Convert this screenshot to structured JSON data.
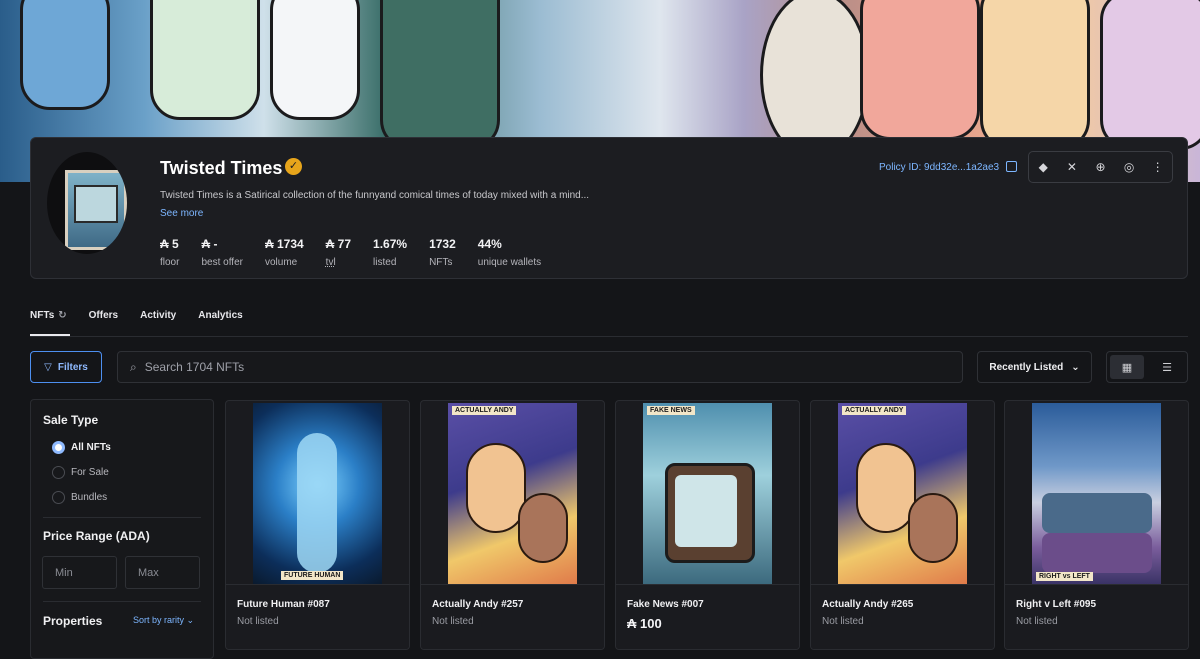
{
  "collection": {
    "title": "Twisted Times",
    "description": "Twisted Times is a Satirical collection of the funnyand comical times of today mixed with a mind...",
    "see_more": "See more",
    "policy": "Policy ID: 9dd32e...1a2ae3",
    "stats": [
      {
        "value": "₳ 5",
        "label": "floor"
      },
      {
        "value": "₳ -",
        "label": "best offer"
      },
      {
        "value": "₳ 1734",
        "label": "volume"
      },
      {
        "value": "₳ 77",
        "label": "tvl"
      },
      {
        "value": "1.67%",
        "label": "listed"
      },
      {
        "value": "1732",
        "label": "NFTs"
      },
      {
        "value": "44%",
        "label": "unique wallets"
      }
    ]
  },
  "tabs": [
    {
      "label": "NFTs"
    },
    {
      "label": "Offers"
    },
    {
      "label": "Activity"
    },
    {
      "label": "Analytics"
    }
  ],
  "toolbar": {
    "filters_label": "Filters",
    "search_placeholder": "Search 1704 NFTs",
    "sort_label": "Recently Listed"
  },
  "sidebar": {
    "sale_type_title": "Sale Type",
    "sale_options": [
      "All NFTs",
      "For Sale",
      "Bundles"
    ],
    "price_title": "Price Range (ADA)",
    "min_placeholder": "Min",
    "max_placeholder": "Max",
    "properties_title": "Properties",
    "sort_by_rarity": "Sort by rarity"
  },
  "cards": [
    {
      "name": "Future Human #087",
      "status": "Not listed",
      "art_label": "FUTURE HUMAN"
    },
    {
      "name": "Actually Andy #257",
      "status": "Not listed",
      "art_label": "ACTUALLY ANDY"
    },
    {
      "name": "Fake News #007",
      "price": "₳ 100",
      "art_label": "FAKE NEWS"
    },
    {
      "name": "Actually Andy #265",
      "status": "Not listed",
      "art_label": "ACTUALLY ANDY"
    },
    {
      "name": "Right v Left #095",
      "status": "Not listed",
      "art_label": "RIGHT vs LEFT"
    }
  ],
  "colors": {
    "accent": "#7db6ff",
    "background": "#141518",
    "verified": "#e7a51b"
  }
}
